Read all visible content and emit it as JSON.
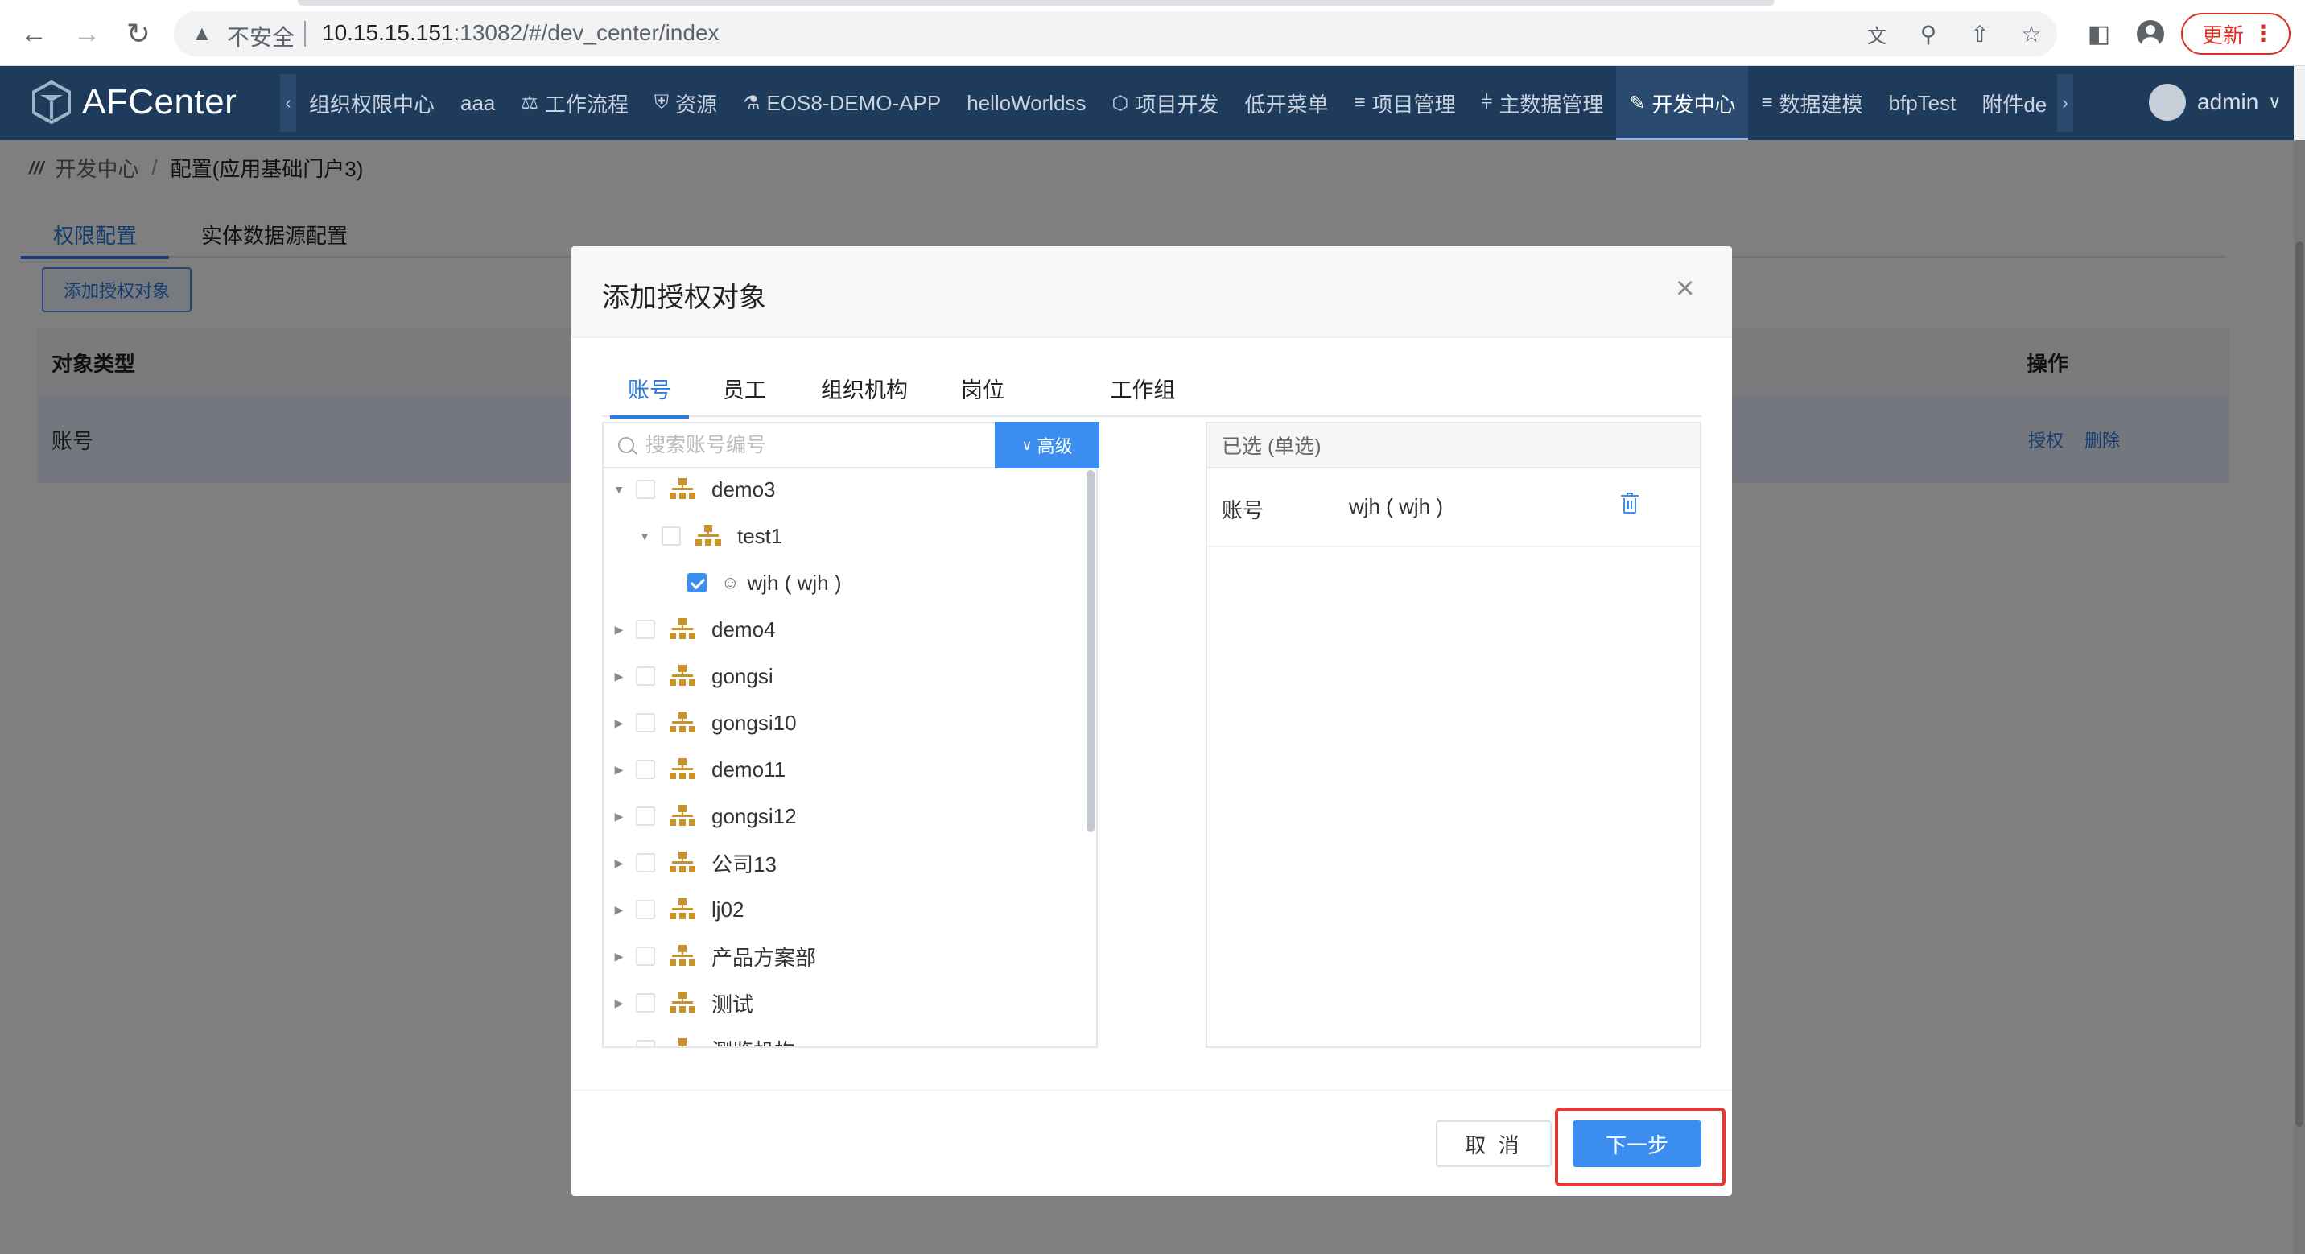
{
  "browser": {
    "security_label": "不安全",
    "url_host": "10.15.15.151",
    "url_rest": ":13082/#/dev_center/index",
    "update_label": "更新"
  },
  "app": {
    "logo_text": "AFCenter",
    "menu": [
      {
        "label": "组织权限中心",
        "icon": ""
      },
      {
        "label": "aaa",
        "icon": ""
      },
      {
        "label": "工作流程",
        "icon": "scale-icon"
      },
      {
        "label": "资源",
        "icon": "shield-icon"
      },
      {
        "label": "EOS8-DEMO-APP",
        "icon": "flask-icon"
      },
      {
        "label": "helloWorldss",
        "icon": ""
      },
      {
        "label": "项目开发",
        "icon": "cube-icon"
      },
      {
        "label": "低开菜单",
        "icon": ""
      },
      {
        "label": "项目管理",
        "icon": "layers-icon"
      },
      {
        "label": "主数据管理",
        "icon": "sliders-icon"
      },
      {
        "label": "开发中心",
        "icon": "edit-icon",
        "active": true
      },
      {
        "label": "数据建模",
        "icon": "layers-icon"
      },
      {
        "label": "bfpTest",
        "icon": ""
      },
      {
        "label": "附件de",
        "icon": ""
      }
    ],
    "user": "admin"
  },
  "breadcrumb": {
    "root": "开发中心",
    "sep": "/",
    "current": "配置(应用基础门户3)"
  },
  "page_tabs": [
    "权限配置",
    "实体数据源配置"
  ],
  "add_button": "添加授权对象",
  "table": {
    "headers": {
      "type": "对象类型",
      "op": "操作"
    },
    "rows": [
      {
        "type": "账号",
        "actions": [
          "授权",
          "删除"
        ]
      }
    ]
  },
  "modal": {
    "title": "添加授权对象",
    "tabs": [
      "账号",
      "员工",
      "组织机构",
      "岗位",
      "工作组"
    ],
    "active_tab": "账号",
    "search_placeholder": "搜索账号编号",
    "advanced_label": "高级",
    "tree": [
      {
        "label": "demo3",
        "level": 0,
        "expanded": true,
        "type": "org",
        "checked": false
      },
      {
        "label": "test1",
        "level": 1,
        "expanded": true,
        "type": "org",
        "checked": false
      },
      {
        "label": "wjh ( wjh )",
        "level": 2,
        "type": "user",
        "checked": true
      },
      {
        "label": "demo4",
        "level": 0,
        "type": "org",
        "checked": false
      },
      {
        "label": "gongsi",
        "level": 0,
        "type": "org",
        "checked": false
      },
      {
        "label": "gongsi10",
        "level": 0,
        "type": "org",
        "checked": false
      },
      {
        "label": "demo11",
        "level": 0,
        "type": "org",
        "checked": false
      },
      {
        "label": "gongsi12",
        "level": 0,
        "type": "org",
        "checked": false
      },
      {
        "label": "公司13",
        "level": 0,
        "type": "org",
        "checked": false
      },
      {
        "label": "lj02",
        "level": 0,
        "type": "org",
        "checked": false
      },
      {
        "label": "产品方案部",
        "level": 0,
        "type": "org",
        "checked": false
      },
      {
        "label": "测试",
        "level": 0,
        "type": "org",
        "checked": false
      },
      {
        "label": "测览机构",
        "level": 0,
        "type": "org",
        "checked": false
      }
    ],
    "selected_header": "已选 (单选)",
    "selected": [
      {
        "type": "账号",
        "name": "wjh ( wjh )"
      }
    ],
    "cancel_label": "取 消",
    "next_label": "下一步"
  },
  "colors": {
    "header_bg": "#1f3b5c",
    "primary": "#3b8ef0",
    "highlight": "#e53935",
    "org_icon": "#c8932a"
  }
}
